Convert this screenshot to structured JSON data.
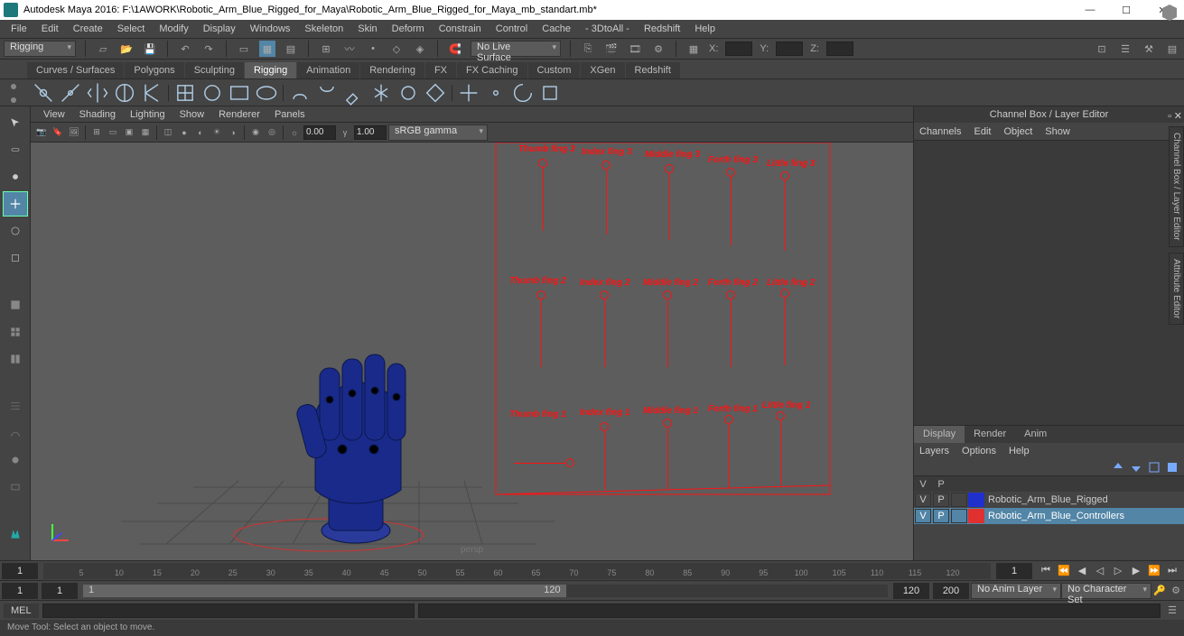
{
  "title": "Autodesk Maya 2016: F:\\1AWORK\\Robotic_Arm_Blue_Rigged_for_Maya\\Robotic_Arm_Blue_Rigged_for_Maya_mb_standart.mb*",
  "menu": [
    "File",
    "Edit",
    "Create",
    "Select",
    "Modify",
    "Display",
    "Windows",
    "Skeleton",
    "Skin",
    "Deform",
    "Constrain",
    "Control",
    "Cache",
    "- 3DtoAll -",
    "Redshift",
    "Help"
  ],
  "module_dd": "Rigging",
  "live_surface": "No Live Surface",
  "coords": {
    "x": "X:",
    "y": "Y:",
    "z": "Z:"
  },
  "shelfTabs": [
    "Curves / Surfaces",
    "Polygons",
    "Sculpting",
    "Rigging",
    "Animation",
    "Rendering",
    "FX",
    "FX Caching",
    "Custom",
    "XGen",
    "Redshift"
  ],
  "shelfActive": "Rigging",
  "vpMenu": [
    "View",
    "Shading",
    "Lighting",
    "Show",
    "Renderer",
    "Panels"
  ],
  "vpExposure": "0.00",
  "vpGamma": "1.00",
  "vpColorSpace": "sRGB gamma",
  "perspLabel": "persp",
  "rigLabels": {
    "r1": [
      "Thumb fing 3",
      "Index fing 3",
      "Middle fing 3",
      "Forth fing 3",
      "Little fing 3"
    ],
    "r2": [
      "Thumb fing 2",
      "Index fing 2",
      "Middle fing 2",
      "Forth fing 2",
      "Little fing 2"
    ],
    "r3": [
      "Thumb fing 1",
      "Index fing 1",
      "Middle fing 1",
      "Forth fing 1",
      "Little fing 1"
    ]
  },
  "channelBox": {
    "title": "Channel Box / Layer Editor",
    "menu": [
      "Channels",
      "Edit",
      "Object",
      "Show"
    ]
  },
  "layerPanel": {
    "tabs": [
      "Display",
      "Render",
      "Anim"
    ],
    "menu": [
      "Layers",
      "Options",
      "Help"
    ],
    "headV": "V",
    "headP": "P",
    "layers": [
      {
        "name": "Robotic_Arm_Blue_Rigged",
        "color": "#2030cc",
        "selected": false
      },
      {
        "name": "Robotic_Arm_Blue_Controllers",
        "color": "#e03030",
        "selected": true
      }
    ]
  },
  "timeline": {
    "ticks": [
      "5",
      "10",
      "15",
      "20",
      "25",
      "30",
      "35",
      "40",
      "45",
      "50",
      "55",
      "60",
      "65",
      "70",
      "75",
      "80",
      "85",
      "90",
      "95",
      "100",
      "105",
      "110",
      "115",
      "120"
    ],
    "current": "1",
    "rangeStart1": "1",
    "rangeStart2": "1",
    "rangeEnd1": "120",
    "rangeEnd2": "120",
    "rangeEnd3": "200",
    "animLayer": "No Anim Layer",
    "charSet": "No Character Set"
  },
  "cmdLabel": "MEL",
  "helpLine": "Move Tool: Select an object to move."
}
